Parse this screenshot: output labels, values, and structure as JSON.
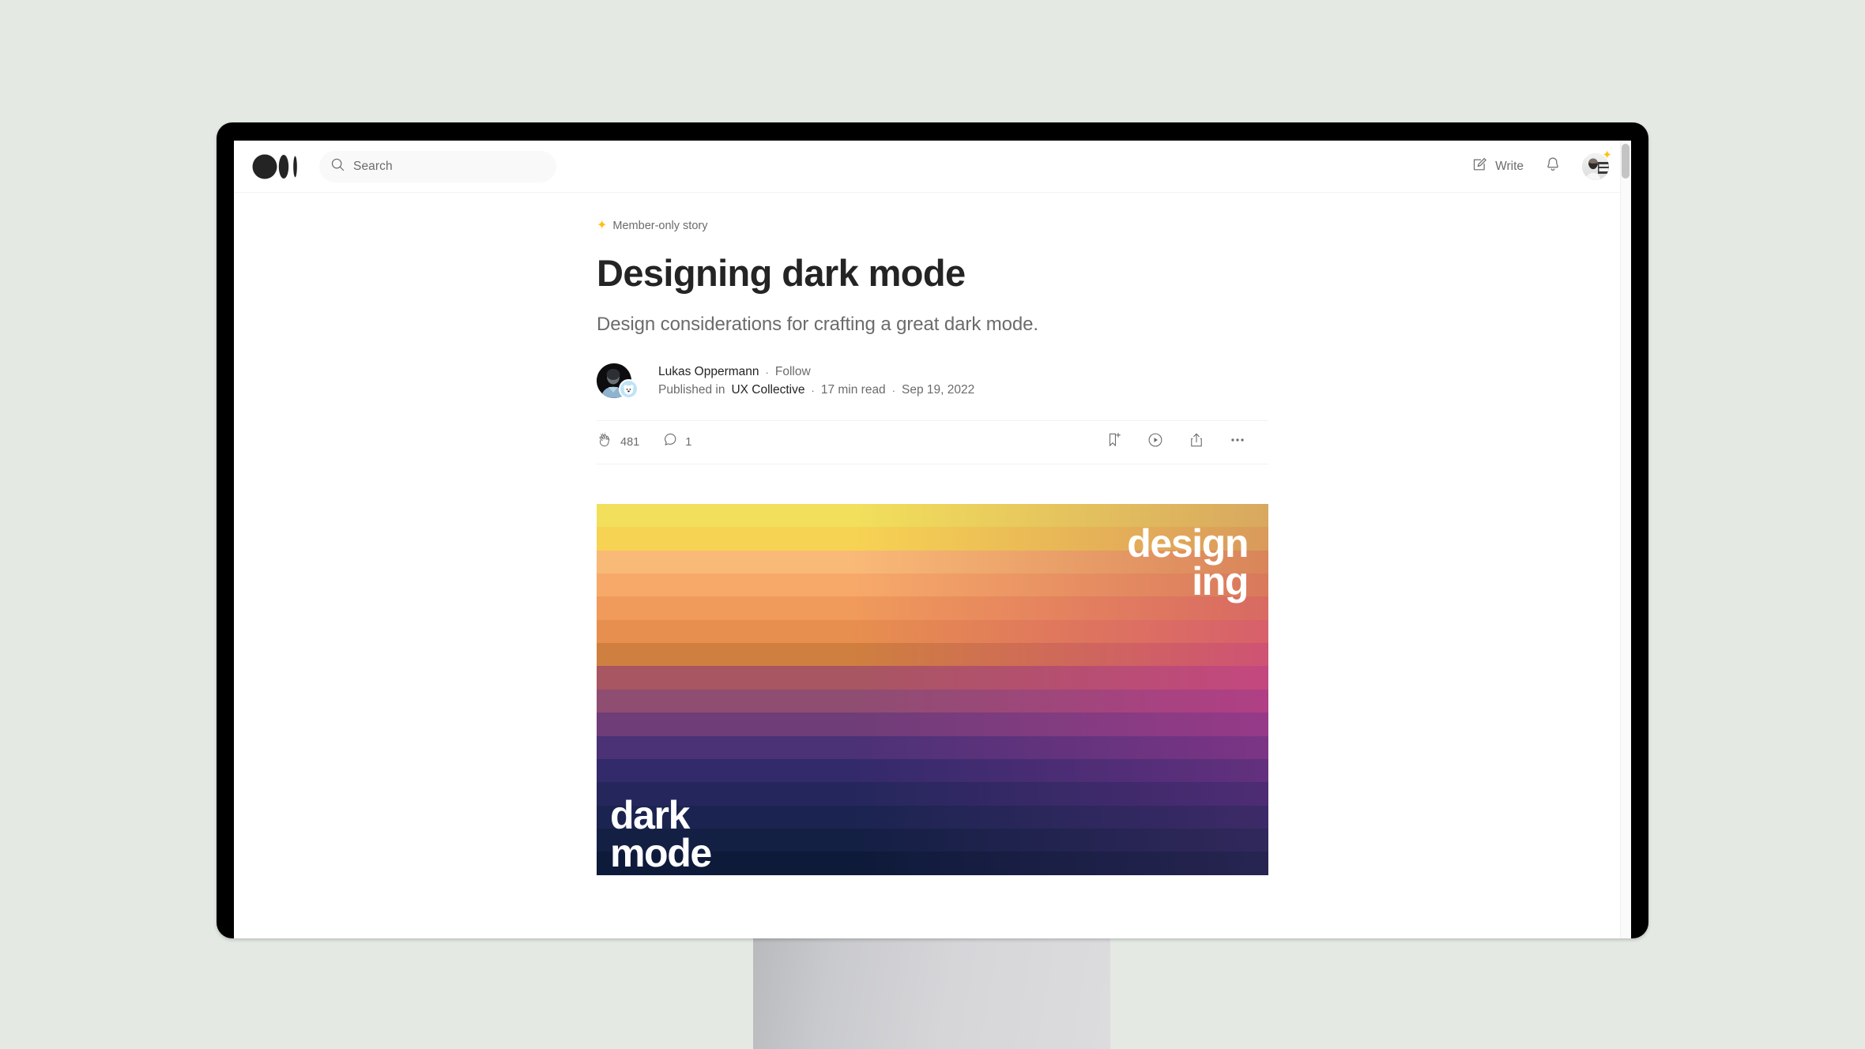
{
  "app": {
    "name": "Medium",
    "logo_icon": "medium-logo-icon"
  },
  "topbar": {
    "search": {
      "placeholder": "Search",
      "value": "",
      "icon": "search-icon"
    },
    "write": {
      "label": "Write",
      "icon": "write-pencil-icon"
    },
    "notifications": {
      "icon": "bell-icon"
    },
    "avatar": {
      "icon": "user-avatar",
      "badge_icon": "member-star-icon",
      "badge_glyph": "✦"
    }
  },
  "article": {
    "member_badge": {
      "glyph": "✦",
      "label": "Member-only story",
      "color": "#ffc017"
    },
    "title": "Designing dark mode",
    "subtitle": "Design considerations for crafting a great dark mode.",
    "byline": {
      "author": "Lukas Oppermann",
      "separator": "·",
      "follow_label": "Follow",
      "published_in_label": "Published in",
      "publication": "UX Collective",
      "read_time": "17 min read",
      "date": "Sep 19, 2022"
    },
    "actions": {
      "clap": {
        "icon": "clap-icon",
        "count": "481"
      },
      "comment": {
        "icon": "comment-icon",
        "count": "1"
      },
      "bookmark": {
        "icon": "bookmark-add-icon"
      },
      "listen": {
        "icon": "play-circle-icon"
      },
      "share": {
        "icon": "share-upload-icon"
      },
      "more": {
        "icon": "more-horizontal-icon"
      }
    },
    "hero": {
      "alt": "Banded gradient cover art",
      "word_top_right_line1": "design",
      "word_top_right_line2": "ing",
      "word_bottom_left_line1": "dark",
      "word_bottom_left_line2": "mode",
      "band_colors_left": [
        "#f2e05c",
        "#f7d353",
        "#f9b977",
        "#f7a96a",
        "#f09a5b",
        "#e78f4f",
        "#cf7f3f",
        "#a85662",
        "#8f4d72",
        "#6f3d78",
        "#4b3176",
        "#332a6b",
        "#25275c",
        "#1b2450",
        "#141f44",
        "#0e1a3a"
      ],
      "band_colors_right": [
        "#d8a85f",
        "#d99a5b",
        "#d9855a",
        "#d9795c",
        "#d86a62",
        "#d7606b",
        "#cf5374",
        "#c3487f",
        "#b03f85",
        "#963a88",
        "#7c3585",
        "#63307e",
        "#4e2c74",
        "#3d2a68",
        "#31285b",
        "#272451"
      ]
    }
  },
  "scrollbar": {
    "position": "top"
  },
  "colors": {
    "page_background": "#e4e9e3",
    "bezel": "#000000",
    "screen": "#ffffff",
    "text_primary": "#242424",
    "text_secondary": "#6b6b6b",
    "accent_member": "#ffc017",
    "stand": "#d6d6d9"
  }
}
